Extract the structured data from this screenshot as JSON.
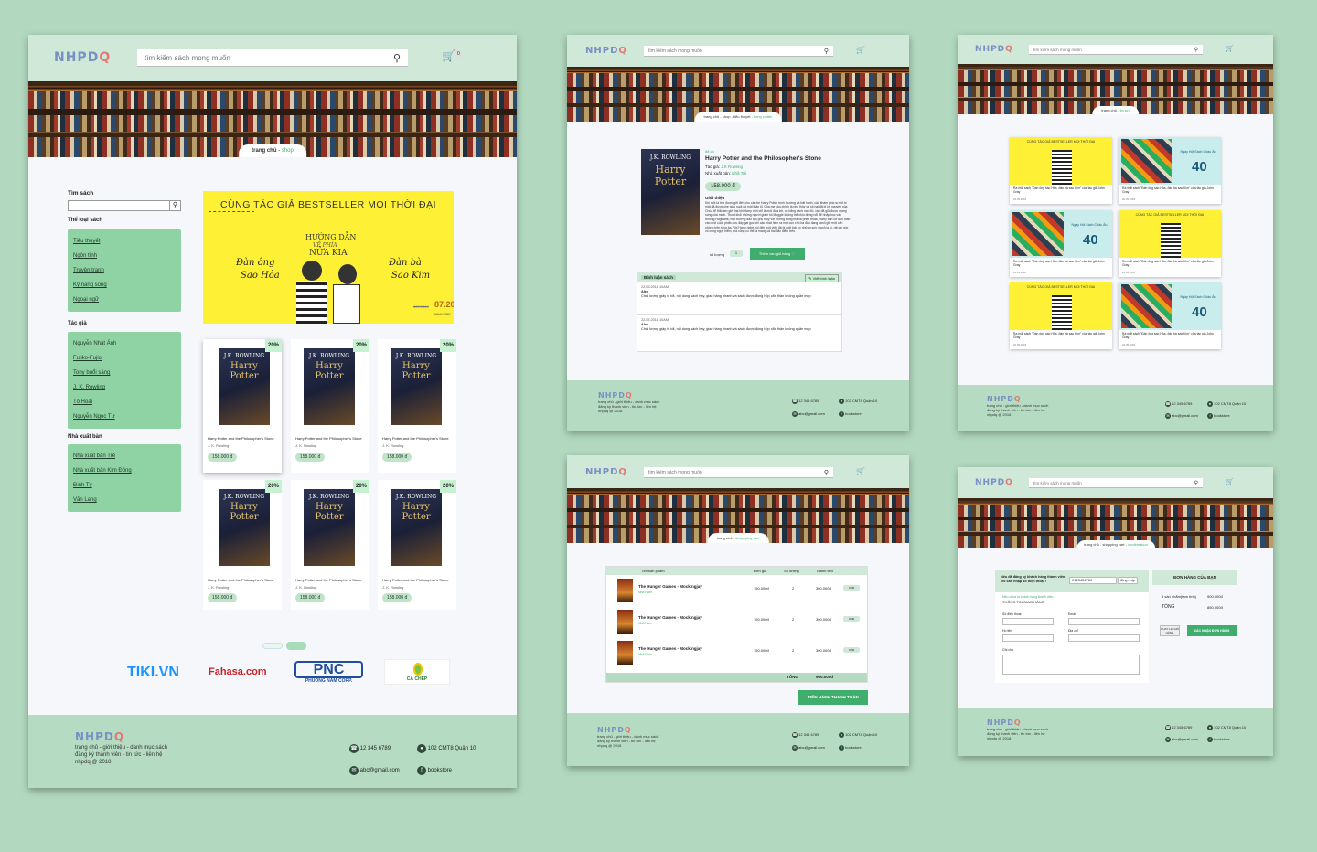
{
  "brand": {
    "logo_main": "NHPD",
    "logo_accent": "Q",
    "footer_logo_main": "NHPD",
    "footer_logo_accent": "Q"
  },
  "search": {
    "placeholder": "tìm kiếm sách mong muốn"
  },
  "cart": {
    "count": "0"
  },
  "footer": {
    "line1": "trang chủ - giới thiệu - danh mục sách",
    "line2": "đăng ký thành viên - tin tức - liên hệ",
    "line3": "nhpdq @ 2018",
    "phone": "12 345 6789",
    "address": "102 CMT8 Quận 10",
    "email": "abc@gmail.com",
    "facebook": "bookstore"
  },
  "shop": {
    "breadcrumb": {
      "home": "trang chủ",
      "sep": " - ",
      "current": "shop"
    },
    "sidebar": {
      "search_title": "Tìm sách",
      "genre_title": "Thể loại sách",
      "genres": [
        "Tiểu thuyết",
        "Ngôn tình",
        "Truyện tranh",
        "Kỹ năng sống",
        "Ngoại ngữ"
      ],
      "author_title": "Tác giả",
      "authors": [
        "Nguyễn Nhật Ánh",
        "Fujiko-Fujio",
        "Tony buổi sáng",
        "J. K. Rowling",
        "Tô Hoài",
        "Nguyễn Ngọc Tư"
      ],
      "publisher_title": "Nhà xuất bản",
      "publishers": [
        "Nhà xuất bản Trẻ",
        "Nhà xuất bản Kim Đồng",
        "Đinh Tỵ",
        "Văn Lang"
      ]
    },
    "promo": {
      "headline": "CÙNG TÁC GIẢ BESTSELLER MỌI THỜI ĐẠI",
      "center": "HƯỚNG DẪN",
      "center2": "VỀ PHÍA",
      "center3": "NỬA KIA",
      "left1": "Đàn ông",
      "left2": "Sao Hỏa",
      "right1": "Đàn bà",
      "right2": "Sao Kim",
      "old_price": "100.000đ",
      "new_price": "87.200",
      "tag": "MUA NGAY"
    },
    "products": [
      {
        "discount": "20%",
        "cover_author": "J.K. ROWLING",
        "cover_title": "Harry Potter",
        "title": "Harry Potter and the Philosopher's Stone",
        "author": "J. K. Rowling",
        "price": "158.000 đ"
      },
      {
        "discount": "20%",
        "cover_author": "J.K. ROWLING",
        "cover_title": "Harry Potter",
        "title": "Harry Potter and the Philosopher's Stone",
        "author": "J. K. Rowling",
        "price": "158.000 đ"
      },
      {
        "discount": "20%",
        "cover_author": "J.K. ROWLING",
        "cover_title": "Harry Potter",
        "title": "Harry Potter and the Philosopher's Stone",
        "author": "J. K. Rowling",
        "price": "158.000 đ"
      },
      {
        "discount": "20%",
        "cover_author": "J.K. ROWLING",
        "cover_title": "Harry Potter",
        "title": "Harry Potter and the Philosopher's Stone",
        "author": "J. K. Rowling",
        "price": "158.000 đ"
      },
      {
        "discount": "20%",
        "cover_author": "J.K. ROWLING",
        "cover_title": "Harry Potter",
        "title": "Harry Potter and the Philosopher's Stone",
        "author": "J. K. Rowling",
        "price": "158.000 đ"
      },
      {
        "discount": "20%",
        "cover_author": "J.K. ROWLING",
        "cover_title": "Harry Potter",
        "title": "Harry Potter and the Philosopher's Stone",
        "author": "J. K. Rowling",
        "price": "158.000 đ"
      }
    ],
    "partners": [
      {
        "name": "TIKI.VN",
        "color": "#1a94ff"
      },
      {
        "name": "Fahasa.com",
        "color": "#c92127"
      },
      {
        "name": "PNC",
        "sub": "PHUONG NAM CORP.",
        "color": "#1f4e9c"
      },
      {
        "name": "CÁ CHÉP",
        "color": "#2a7a3a"
      }
    ]
  },
  "detail": {
    "breadcrumb": {
      "a": "trang chủ",
      "b": "shop",
      "c": "tiểu thuyết",
      "current": "harry potter"
    },
    "tag": "đã có",
    "title": "Harry Potter and the Philosopher's Stone",
    "author_label": "Tác giả:",
    "author": "J.K Rowling",
    "publisher_label": "Nhà xuất bản:",
    "publisher": "Nhã Trẻ",
    "price": "158.000 đ",
    "intro_label": "Giới thiệu",
    "intro": "Khi một lá thư được gởi đến cho cậu bé Harry Potter bình thường và bất hạnh, cậu khám phá ra một bí mật đã được che giấu suốt cả một thập kỉ. Cha mẹ cậu chính là phù thủy và cả hai đã bị lời nguyền của Chúa tể Hắc ám giết hại khi Harry mới chỉ là một đứa trẻ, và bằng cách nào đó, cậu đã giữ được mạng sống của mình. Thoát khỏi những người giám hộ Muggle không thể chịu đựng nổi để nhập học vào trường Hogwarts, một trường đào tạo phù thủy với những bóng ma và phép thuật, Harry tình cờ dấn thân vào một cuộc phiêu lưu đầy gai góc khi cậu phát hiện ra một con chó ba đầu đang canh giữ một căn phòng trên tầng ba. Rồi Harry nghe nói đến một viên đá bị mất tích có những sức mạnh lạ kì, rất quí giá, vô cùng nguy hiểm, mà cũng có thể là mang cả hai đặc điểm trên.",
    "qty_label": "số lượng",
    "qty": "1",
    "add_btn": "Thêm vào giỏ hàng",
    "reviews_title": "Bình luận sách",
    "write_btn": "Viết bình luận",
    "reviews": [
      {
        "date": "22.05.2018 10AM",
        "name": "Alex",
        "text": "Chất lượng giấy in tốt, nội dung sách hay, giao hàng nhanh và sách được đóng hộp cẩn thận không quăn mép"
      },
      {
        "date": "22.05.2018 10AM",
        "name": "Alex",
        "text": "Chất lượng giấy in tốt, nội dung sách hay, giao hàng nhanh và sách được đóng hộp cẩn thận không quăn mép"
      }
    ]
  },
  "news": {
    "breadcrumb": {
      "home": "trang chủ",
      "current": "tin tức"
    },
    "items": [
      {
        "type": "yellow",
        "headline": "CÙNG TÁC GIẢ BESTSELLER MỌI THỜI ĐẠI",
        "caption": "Ra mắt sách \"Đàn ông sao Hỏa, đàn bà sao Kim\" của tác giả John Gray",
        "date": "22.05.2018"
      },
      {
        "type": "blue",
        "headline": "Ngày Hội Sách Châu Âu",
        "sale": "40",
        "caption": "Ra mắt sách \"Đàn ông sao Hỏa, đàn bà sao Kim\" của tác giả John Gray",
        "date": "22.05.2018"
      },
      {
        "type": "blue",
        "headline": "Ngày Hội Sách Châu Âu",
        "sale": "40",
        "caption": "Ra mắt sách \"Đàn ông sao Hỏa, đàn bà sao Kim\" của tác giả John Gray",
        "date": "22.05.2018"
      },
      {
        "type": "yellow",
        "headline": "CÙNG TÁC GIẢ BESTSELLER MỌI THỜI ĐẠI",
        "caption": "Ra mắt sách \"Đàn ông sao Hỏa, đàn bà sao Kim\" của tác giả John Gray",
        "date": "22.05.2018"
      },
      {
        "type": "yellow",
        "headline": "CÙNG TÁC GIẢ BESTSELLER MỌI THỜI ĐẠI",
        "caption": "Ra mắt sách \"Đàn ông sao Hỏa, đàn bà sao Kim\" của tác giả John Gray",
        "date": "22.05.2018"
      },
      {
        "type": "blue",
        "headline": "Ngày Hội Sách Châu Âu",
        "sale": "40",
        "caption": "Ra mắt sách \"Đàn ông sao Hỏa, đàn bà sao Kim\" của tác giả John Gray",
        "date": "22.05.2018"
      }
    ]
  },
  "cartpage": {
    "breadcrumb": {
      "home": "trang chủ",
      "current": "shoppping cart"
    },
    "headers": [
      "Tên sản phẩm",
      "Đơn giá",
      "Số lượng",
      "Thành tiền"
    ],
    "rows": [
      {
        "name": "The Hunger Games - Mockingjay",
        "pub": "Nhã Nam",
        "price": "150.000đ",
        "qty": "2",
        "total": "300.000đ",
        "action": "xóa"
      },
      {
        "name": "The Hunger Games - Mockingjay",
        "pub": "Nhã Nam",
        "price": "150.000đ",
        "qty": "2",
        "total": "300.000đ",
        "action": "xóa"
      },
      {
        "name": "The Hunger Games - Mockingjay",
        "pub": "Nhã Nam",
        "price": "150.000đ",
        "qty": "2",
        "total": "300.000đ",
        "action": "xóa"
      }
    ],
    "total_label": "TỔNG",
    "total": "900.000đ",
    "checkout": "TIẾN HÀNH THANH TOÁN"
  },
  "confirm": {
    "breadcrumb": {
      "a": "trang chủ",
      "b": "shopping cart",
      "current": "confirmation"
    },
    "member_q": "Nếu đã đăng ký khách hàng thành viên, chỉ cần nhập số điện thoại !",
    "phone_value": "0123456789",
    "login_btn": "đăng nhập",
    "nonmember": "Nếu chưa là khách hàng thành viên:",
    "ship_title": "THÔNG TIN GIAO HÀNG",
    "f_phone": "Số điện thoại",
    "f_email": "Email",
    "f_name": "Họ tên",
    "f_addr": "Địa chỉ",
    "f_note": "Ghi chú",
    "order_title": "ĐƠN HÀNG CỦA BẠN",
    "items_label": "3 sản phẩm(tạm tính)",
    "items_value": "900.000đ",
    "total_label": "TỔNG",
    "total_value": "850.000đ",
    "back_btn": "QUAY LẠI GIỎ HÀNG",
    "confirm_btn": "XÁC NHẬN ĐƠN HÀNG"
  }
}
